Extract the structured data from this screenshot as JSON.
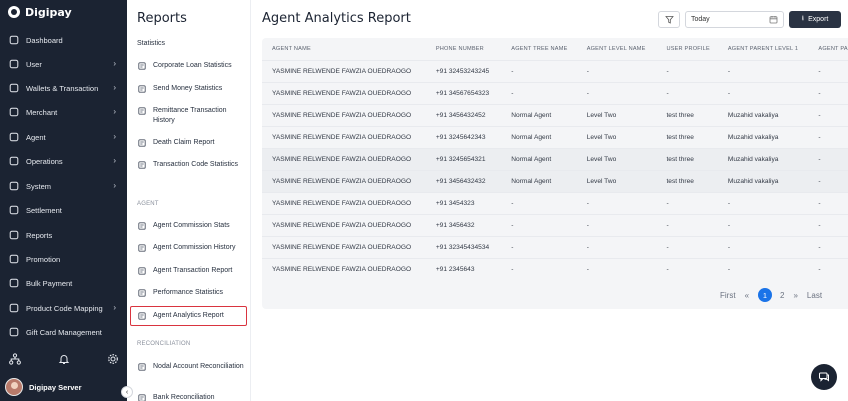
{
  "app": {
    "name": "Digipay"
  },
  "sidebar": {
    "items": [
      {
        "label": "Dashboard",
        "icon": "dashboard-icon",
        "chevron": false
      },
      {
        "label": "User",
        "icon": "user-icon",
        "chevron": true
      },
      {
        "label": "Wallets & Transaction",
        "icon": "wallet-icon",
        "chevron": true
      },
      {
        "label": "Merchant",
        "icon": "merchant-icon",
        "chevron": true
      },
      {
        "label": "Agent",
        "icon": "agent-icon",
        "chevron": true
      },
      {
        "label": "Operations",
        "icon": "operations-icon",
        "chevron": true
      },
      {
        "label": "System",
        "icon": "system-icon",
        "chevron": true
      },
      {
        "label": "Settlement",
        "icon": "settlement-icon",
        "chevron": false
      },
      {
        "label": "Reports",
        "icon": "reports-icon",
        "chevron": false
      },
      {
        "label": "Promotion",
        "icon": "promotion-icon",
        "chevron": false
      },
      {
        "label": "Bulk Payment",
        "icon": "bulk-payment-icon",
        "chevron": false
      },
      {
        "label": "Product Code Mapping",
        "icon": "product-code-icon",
        "chevron": true
      },
      {
        "label": "Gift Card Management",
        "icon": "gift-card-icon",
        "chevron": false
      }
    ],
    "user": {
      "name": "Digipay Server"
    }
  },
  "reports_panel": {
    "title": "Reports",
    "items_top": [
      {
        "label": "Statistics",
        "icon": "none"
      },
      {
        "label": "Corporate Loan Statistics",
        "icon": "document-icon"
      },
      {
        "label": "Send Money Statistics",
        "icon": "send-money-icon"
      },
      {
        "label": "Remittance Transaction History",
        "icon": "remittance-icon"
      },
      {
        "label": "Death Claim Report",
        "icon": "heart-icon"
      },
      {
        "label": "Transaction Code Statistics",
        "icon": "bar-chart-icon"
      }
    ],
    "agent_section": "AGENT",
    "agent_items": [
      {
        "label": "Agent Commission Stats",
        "icon": "users-icon"
      },
      {
        "label": "Agent Commission History",
        "icon": "history-icon"
      },
      {
        "label": "Agent Transaction Report",
        "icon": "history-icon"
      },
      {
        "label": "Performance Statistics",
        "icon": "bar-chart-icon"
      },
      {
        "label": "Agent Analytics Report",
        "icon": "report-icon"
      }
    ],
    "recon_section": "RECONCILIATION",
    "recon_items": [
      {
        "label": "Nodal Account Reconciliation",
        "icon": "network-icon"
      },
      {
        "label": "Bank Reconciliation",
        "icon": "bank-icon"
      }
    ]
  },
  "main": {
    "title": "Agent Analytics Report",
    "date_value": "Today",
    "export_label": "Export",
    "columns": [
      "AGENT NAME",
      "PHONE NUMBER",
      "AGENT TREE NAME",
      "AGENT LEVEL NAME",
      "USER PROFILE",
      "AGENT PARENT LEVEL 1",
      "AGENT PARENT LEV"
    ],
    "rows": [
      [
        "YASMINE RELWENDE FAWZIA OUEDRAOGO",
        "+91 32453243245",
        "-",
        "-",
        "-",
        "-",
        "-"
      ],
      [
        "YASMINE RELWENDE FAWZIA OUEDRAOGO",
        "+91 34567654323",
        "-",
        "-",
        "-",
        "-",
        "-"
      ],
      [
        "YASMINE RELWENDE FAWZIA OUEDRAOGO",
        "+91 3456432452",
        "Normal Agent",
        "Level Two",
        "test three",
        "Muzahid vakaliya",
        "-"
      ],
      [
        "YASMINE RELWENDE FAWZIA OUEDRAOGO",
        "+91 3245642343",
        "Normal Agent",
        "Level Two",
        "test three",
        "Muzahid vakaliya",
        "-"
      ],
      [
        "YASMINE RELWENDE FAWZIA OUEDRAOGO",
        "+91 3245654321",
        "Normal Agent",
        "Level Two",
        "test three",
        "Muzahid vakaliya",
        "-"
      ],
      [
        "YASMINE RELWENDE FAWZIA OUEDRAOGO",
        "+91 3456432432",
        "Normal Agent",
        "Level Two",
        "test three",
        "Muzahid vakaliya",
        "-"
      ],
      [
        "YASMINE RELWENDE FAWZIA OUEDRAOGO",
        "+91 3454323",
        "-",
        "-",
        "-",
        "-",
        "-"
      ],
      [
        "YASMINE RELWENDE FAWZIA OUEDRAOGO",
        "+91 3456432",
        "-",
        "-",
        "-",
        "-",
        "-"
      ],
      [
        "YASMINE RELWENDE FAWZIA OUEDRAOGO",
        "+91 32345434534",
        "-",
        "-",
        "-",
        "-",
        "-"
      ],
      [
        "YASMINE RELWENDE FAWZIA OUEDRAOGO",
        "+91 2345643",
        "-",
        "-",
        "-",
        "-",
        "-"
      ]
    ],
    "pagination": {
      "first": "First",
      "prev": "«",
      "current": "1",
      "next_page": "2",
      "next": "»",
      "last": "Last"
    }
  },
  "colors": {
    "sidebar_bg": "#1b2332",
    "accent": "#1a73e8",
    "active_outline": "#d9343f"
  }
}
